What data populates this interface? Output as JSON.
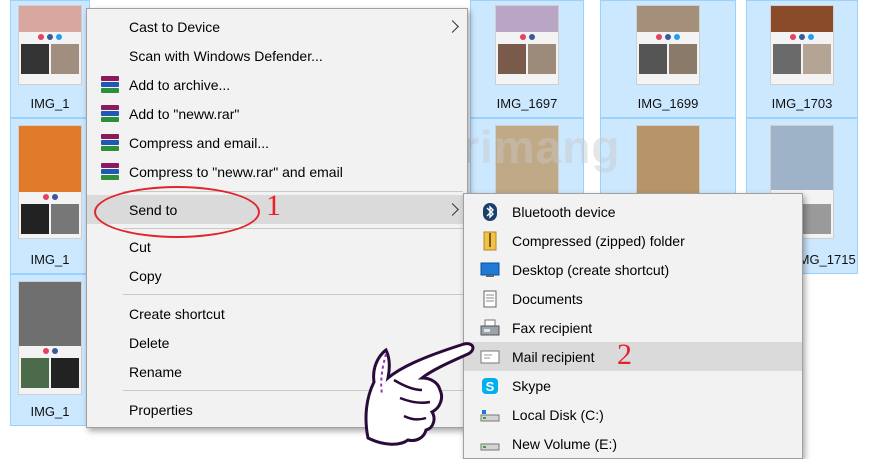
{
  "files": [
    {
      "name": "IMG_1",
      "row": 1,
      "col": 1
    },
    {
      "name": "IMG_1697",
      "row": 1,
      "col": 3
    },
    {
      "name": "IMG_1699",
      "row": 1,
      "col": 4
    },
    {
      "name": "IMG_1703",
      "row": 1,
      "col": 5
    },
    {
      "name": "IMG_1",
      "row": 2,
      "col": 1
    },
    {
      "name": "IMG_1715",
      "row": 2,
      "col": 5
    },
    {
      "name": "IMG_1",
      "row": 3,
      "col": 1
    }
  ],
  "context_menu": {
    "items": [
      {
        "label": "Cast to Device",
        "submenu": true
      },
      {
        "label": "Scan with Windows Defender...",
        "submenu": false
      },
      {
        "label": "Add to archive...",
        "icon": "winrar-icon"
      },
      {
        "label": "Add to \"neww.rar\"",
        "icon": "winrar-icon"
      },
      {
        "label": "Compress and email...",
        "icon": "winrar-icon"
      },
      {
        "label": "Compress to \"neww.rar\" and email",
        "icon": "winrar-icon"
      },
      {
        "label": "Send to",
        "submenu": true,
        "highlighted": true
      },
      {
        "label": "Cut"
      },
      {
        "label": "Copy"
      },
      {
        "label": "Create shortcut"
      },
      {
        "label": "Delete"
      },
      {
        "label": "Rename"
      },
      {
        "label": "Properties"
      }
    ]
  },
  "send_to_menu": {
    "items": [
      {
        "label": "Bluetooth device",
        "icon": "bluetooth-icon"
      },
      {
        "label": "Compressed (zipped) folder",
        "icon": "zip-folder-icon"
      },
      {
        "label": "Desktop (create shortcut)",
        "icon": "desktop-icon"
      },
      {
        "label": "Documents",
        "icon": "documents-icon"
      },
      {
        "label": "Fax recipient",
        "icon": "fax-icon"
      },
      {
        "label": "Mail recipient",
        "icon": "mail-icon",
        "highlighted": true
      },
      {
        "label": "Skype",
        "icon": "skype-icon"
      },
      {
        "label": "Local Disk (C:)",
        "icon": "drive-icon"
      },
      {
        "label": "New Volume (E:)",
        "icon": "drive-icon"
      }
    ]
  },
  "annotations": {
    "step1": "1",
    "step2": "2"
  },
  "watermark": "uantrimang",
  "colors": {
    "selection": "#cce8ff",
    "selection_border": "#99d1ff",
    "menu_bg": "#f2f2f2",
    "highlight": "#dadada",
    "annotation": "#e0262d"
  }
}
